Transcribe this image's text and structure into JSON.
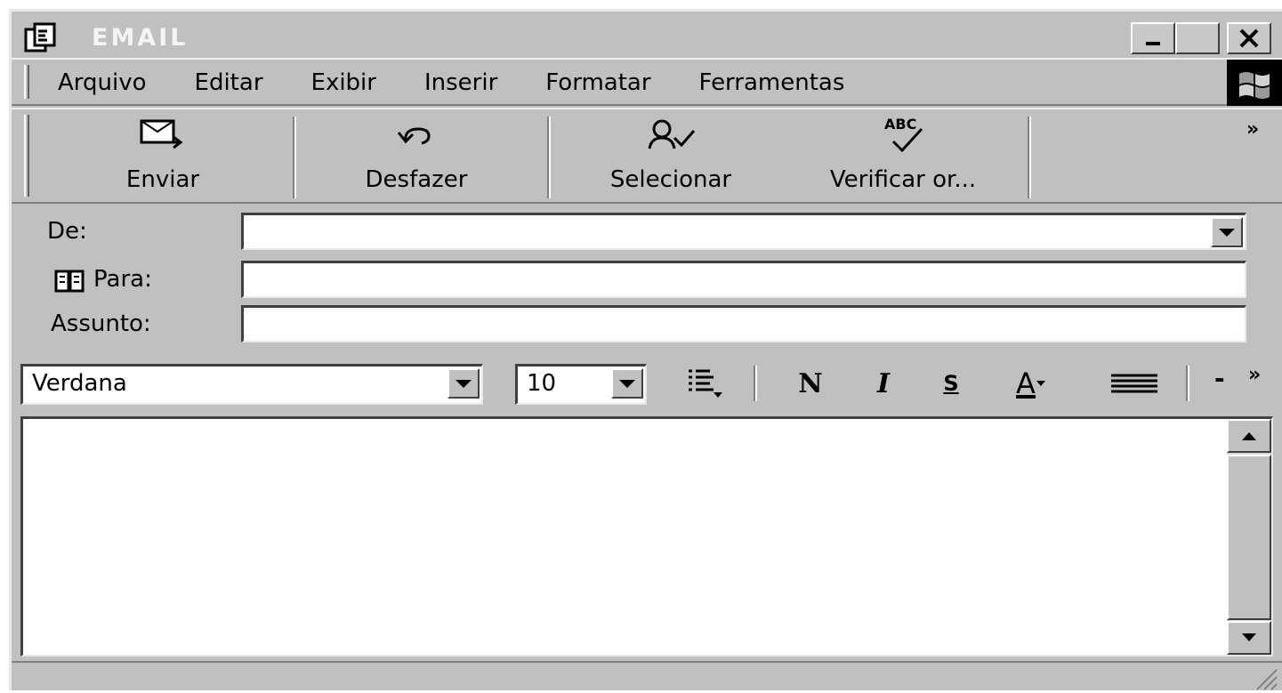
{
  "window": {
    "title": "EMAIL",
    "controls": {
      "minimize": "minimize",
      "maximize": "maximize",
      "close": "close"
    }
  },
  "menu": {
    "items": [
      "Arquivo",
      "Editar",
      "Exibir",
      "Inserir",
      "Formatar",
      "Ferramentas"
    ]
  },
  "toolbar": {
    "send_label": "Enviar",
    "undo_label": "Desfazer",
    "select_label": "Selecionar",
    "spell_label": "Verificar or...",
    "spell_icon_text": "ABC",
    "more": "»"
  },
  "header": {
    "from_label": "De:",
    "from_value": "",
    "to_label": "Para:",
    "to_value": "",
    "subject_label": "Assunto:",
    "subject_value": ""
  },
  "format": {
    "font": "Verdana",
    "size": "10",
    "bold_glyph": "N",
    "italic_glyph": "I",
    "strike_glyph": "S",
    "color_glyph": "A",
    "minus": "-",
    "more": "»"
  },
  "body": {
    "text": ""
  },
  "colors": {
    "chrome": "#c0c0c0",
    "title_text": "#f4f4f4"
  }
}
